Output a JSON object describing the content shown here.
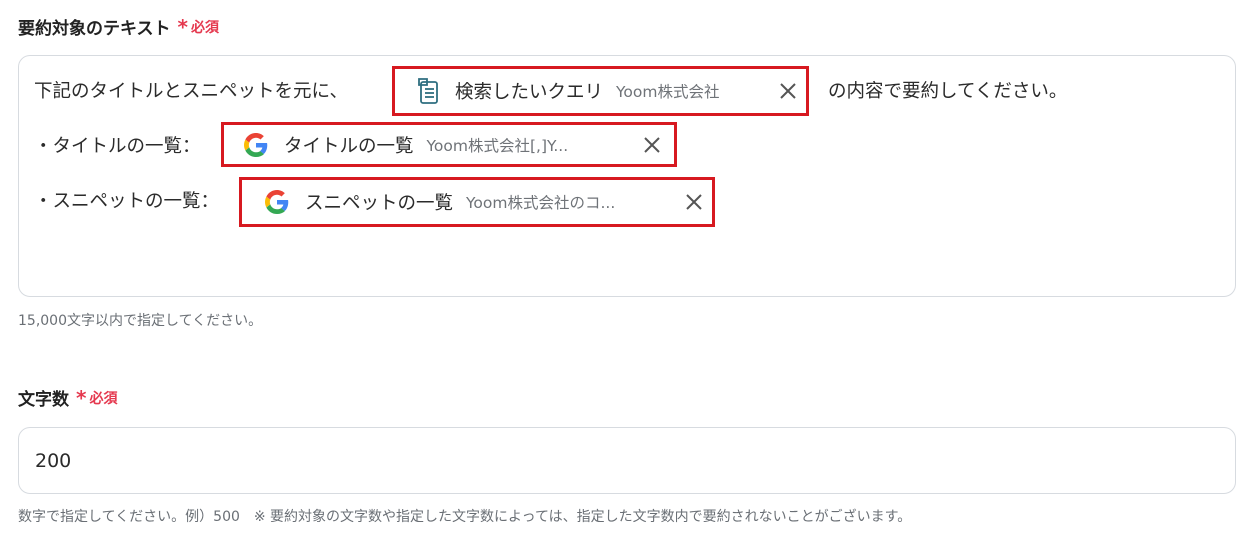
{
  "summary_field": {
    "label": "要約対象のテキスト",
    "required_mark": "*",
    "required_text": "必須",
    "line1_prefix": "下記のタイトルとスニペットを元に、",
    "line1_suffix": "の内容で要約してください。",
    "line2_prefix": "・タイトルの一覧：",
    "line3_prefix": "・スニペットの一覧：",
    "chips": [
      {
        "icon": "form-trigger-icon",
        "label": "検索したいクエリ",
        "value": "Yoom株式会社"
      },
      {
        "icon": "google-icon",
        "label": "タイトルの一覧",
        "value": "Yoom株式会社[,]Y..."
      },
      {
        "icon": "google-icon",
        "label": "スニペットの一覧",
        "value": "Yoom株式会社のコ..."
      }
    ],
    "hint": "15,000文字以内で指定してください。"
  },
  "char_count_field": {
    "label": "文字数",
    "required_mark": "*",
    "required_text": "必須",
    "value": "200",
    "hint": "数字で指定してください。例）500　※ 要約対象の文字数や指定した文字数によっては、指定した文字数内で要約されないことがございます。"
  },
  "colors": {
    "required": "#e5394f",
    "highlight_border": "#d71920",
    "field_border": "#d7dbe0"
  }
}
